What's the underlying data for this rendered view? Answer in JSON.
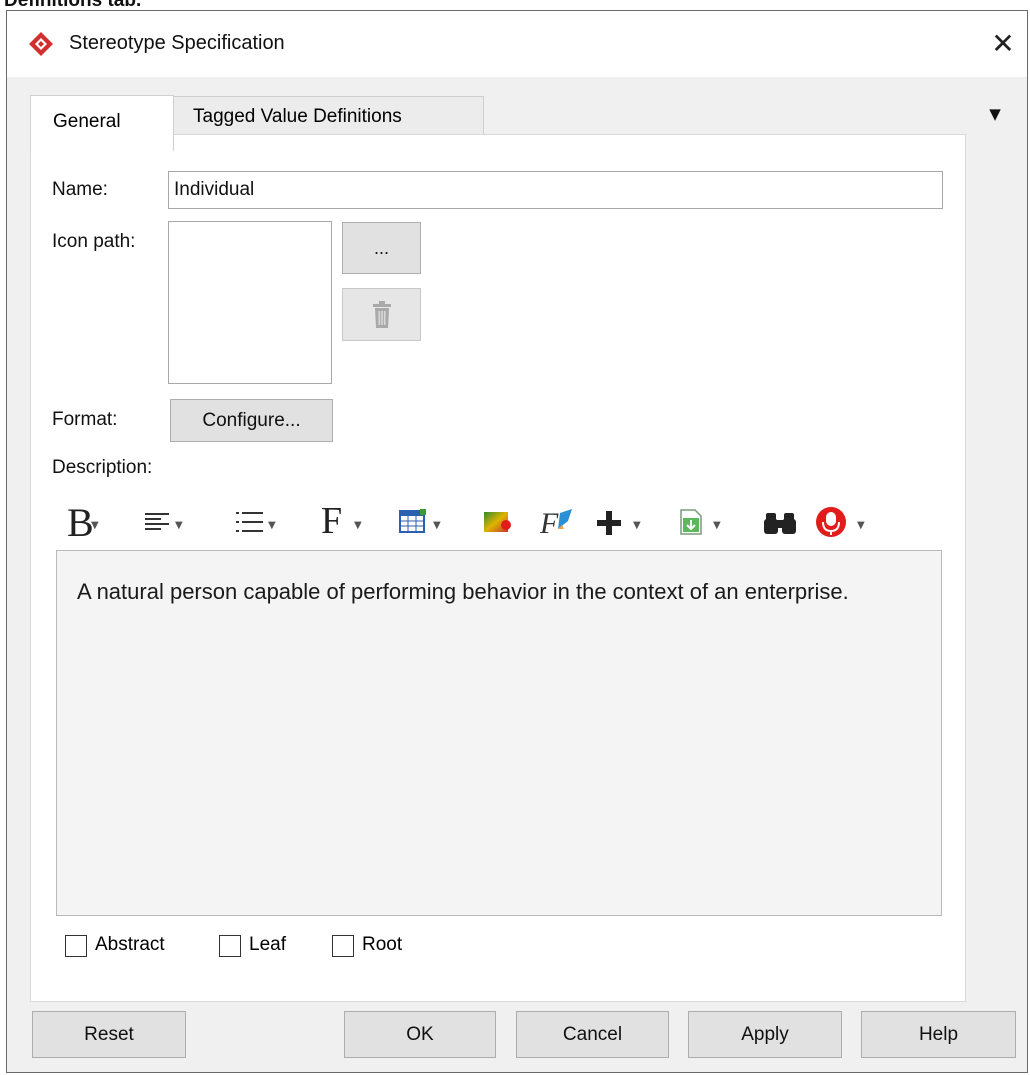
{
  "top_strip": {
    "text": "Definitions tab."
  },
  "window": {
    "title": "Stereotype Specification",
    "close_glyph": "✕",
    "app_icon": "visual-paradigm-logo-icon"
  },
  "tabs": [
    {
      "label": "General",
      "active": true
    },
    {
      "label": "Tagged Value Definitions",
      "active": false
    }
  ],
  "tab_menu_glyph": "▼",
  "general": {
    "name_label": "Name:",
    "name_value": "Individual",
    "icon_path_label": "Icon path:",
    "browse_label": "...",
    "delete_icon": "trash-icon",
    "format_label": "Format:",
    "configure_label": "Configure...",
    "description_label": "Description:",
    "description_text": "A natural person capable of performing behavior in the context of an enterprise.",
    "toolbar": [
      {
        "icon": "bold-icon",
        "has_dropdown": true
      },
      {
        "icon": "align-left-icon",
        "has_dropdown": true
      },
      {
        "icon": "list-icon",
        "has_dropdown": true
      },
      {
        "icon": "font-icon",
        "has_dropdown": true
      },
      {
        "icon": "table-icon",
        "has_dropdown": true
      },
      {
        "icon": "color-icon",
        "has_dropdown": false
      },
      {
        "icon": "format-brush-icon",
        "has_dropdown": false
      },
      {
        "icon": "insert-icon",
        "has_dropdown": true
      },
      {
        "icon": "export-icon",
        "has_dropdown": true
      },
      {
        "icon": "binoculars-icon",
        "has_dropdown": false
      },
      {
        "icon": "microphone-icon",
        "has_dropdown": true
      }
    ],
    "toolbar_glyphs": {
      "bold": "B",
      "font": "F"
    },
    "checkboxes": [
      {
        "label": "Abstract",
        "checked": false
      },
      {
        "label": "Leaf",
        "checked": false
      },
      {
        "label": "Root",
        "checked": false
      }
    ]
  },
  "footer": {
    "reset": "Reset",
    "ok": "OK",
    "cancel": "Cancel",
    "apply": "Apply",
    "help": "Help"
  },
  "colors": {
    "window_bg": "#f0f0f0",
    "button_bg": "#e1e1e1",
    "app_icon_red": "#d32f2f",
    "mic_red": "#e21b1b"
  }
}
